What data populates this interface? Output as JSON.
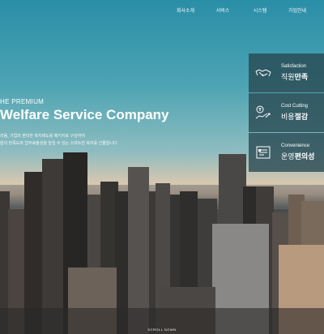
{
  "nav": {
    "items": [
      {
        "label": "회사소개"
      },
      {
        "label": "서비스"
      },
      {
        "label": "시스템"
      },
      {
        "label": "가입안내"
      }
    ]
  },
  "hero": {
    "tagline": "HE PREMIUM",
    "title": "Welfare Service Company",
    "desc_line1": "리움, 기업의 편리한 복지제도를 패키지로 구성하여",
    "desc_line2": "원의 만족도와 업무효율성을 높일 수 있는 스마트한 복지를 선물합니다."
  },
  "features": [
    {
      "en": "Satisfaction",
      "ko_plain": "직원",
      "ko_bold": "만족",
      "icon": "handshake-icon"
    },
    {
      "en": "Cost Cutting",
      "ko_plain": "비용",
      "ko_bold": "절감",
      "icon": "cost-cutting-icon"
    },
    {
      "en": "Convenience",
      "ko_plain": "운영",
      "ko_bold": "편의성",
      "icon": "convenience-icon"
    }
  ],
  "scroll_label": "SCROLL DOWN"
}
